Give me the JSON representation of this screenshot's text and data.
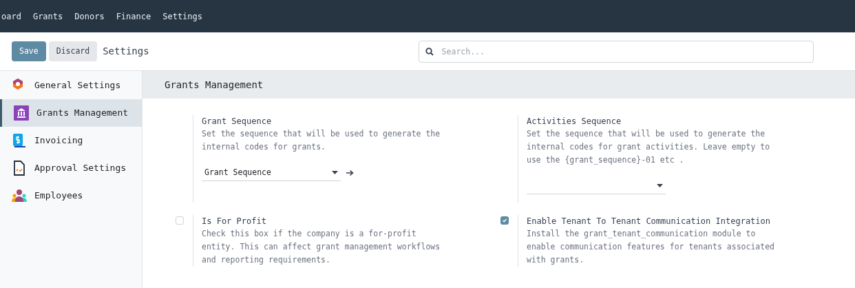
{
  "nav": {
    "items": [
      "oard",
      "Grants",
      "Donors",
      "Finance",
      "Settings"
    ]
  },
  "toolbar": {
    "buttons": [
      {
        "label": "Save",
        "kind": "primary"
      },
      {
        "label": "Discard",
        "kind": "secondary"
      }
    ],
    "title": "Settings",
    "search": {
      "placeholder": "Search..."
    }
  },
  "sidebar": {
    "items": [
      {
        "label": "General Settings",
        "selected": false
      },
      {
        "label": "Grants Management",
        "selected": true
      },
      {
        "label": "Invoicing",
        "selected": false
      },
      {
        "label": "Approval Settings",
        "selected": false
      },
      {
        "label": "Employees",
        "selected": false
      }
    ]
  },
  "section": {
    "title": "Grants Management",
    "settings": [
      {
        "kind": "select",
        "title": "Grant Sequence",
        "description": "Set the sequence that will be used to generate the internal codes for grants.",
        "value": "Grant Sequence",
        "link": true
      },
      {
        "kind": "select",
        "title": "Activities Sequence",
        "description": "Set the sequence that will be used to generate the internal codes for grant activities. Leave empty to use the {grant_sequence}-01 etc .",
        "link": false
      },
      {
        "kind": "checkbox",
        "title": "Is For Profit",
        "description": "Check this box if the company is a for-profit entity. This can affect grant management workflows and reporting requirements.",
        "checked": false
      },
      {
        "kind": "checkbox",
        "title": "Enable Tenant To Tenant Communication Integration",
        "description": "Install the grant_tenant_communication module to enable communication features for tenants associated with grants.",
        "checked": true
      }
    ]
  }
}
